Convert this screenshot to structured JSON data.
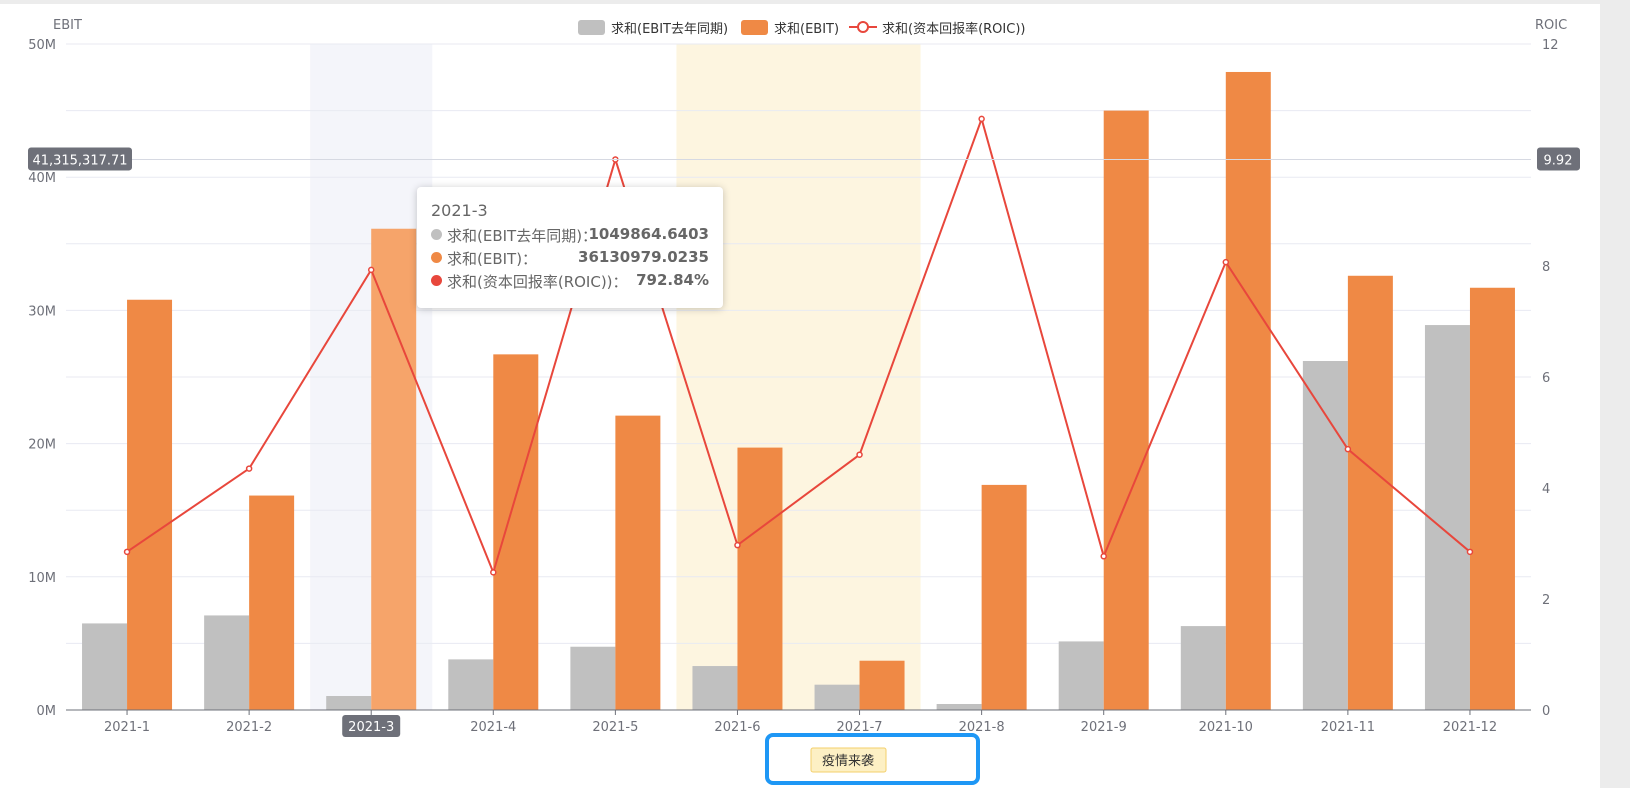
{
  "chart_data": {
    "type": "bar",
    "categories": [
      "2021-1",
      "2021-2",
      "2021-3",
      "2021-4",
      "2021-5",
      "2021-6",
      "2021-7",
      "2021-8",
      "2021-9",
      "2021-10",
      "2021-11",
      "2021-12"
    ],
    "series": [
      {
        "name": "求和(EBIT去年同期)",
        "kind": "bar",
        "axis": "left",
        "values": [
          6500000,
          7100000,
          1049864.6403,
          3800000,
          4750000,
          3300000,
          1900000,
          450000,
          5150000,
          6300000,
          26200000,
          28900000
        ]
      },
      {
        "name": "求和(EBIT)",
        "kind": "bar",
        "axis": "left",
        "values": [
          30800000,
          16100000,
          36130979.0235,
          26700000,
          22100000,
          19700000,
          3700000,
          16900000,
          45000000,
          47900000,
          32600000,
          31700000
        ]
      },
      {
        "name": "求和(资本回报率(ROIC))",
        "kind": "line",
        "axis": "right",
        "values": [
          2.85,
          4.35,
          7.93,
          2.48,
          9.92,
          2.97,
          4.6,
          10.65,
          2.77,
          8.07,
          4.7,
          2.85
        ]
      }
    ],
    "ylabel_left": "EBIT",
    "ylabel_right": "ROIC",
    "ylim_left": [
      0,
      50000000
    ],
    "ylim_right": [
      0,
      12
    ],
    "yticks_left": [
      0,
      10000000,
      20000000,
      30000000,
      40000000,
      50000000
    ],
    "yticks_left_labels": [
      "0M",
      "10M",
      "20M",
      "30M",
      "40M",
      "50M"
    ],
    "yticks_right": [
      0,
      2,
      4,
      6,
      8,
      12
    ],
    "yticks_right_labels": [
      "0",
      "2",
      "4",
      "6",
      "8",
      "12"
    ],
    "grid": true,
    "legend_position": "top-center",
    "colors": {
      "bar_prev": "#c0c0c0",
      "bar_ebit": "#ef8945",
      "bar_ebit_hover": "#f6a46a",
      "line": "#e8473c",
      "axis_label_bg": "#6e7079",
      "hover_band": "#f4f5fa",
      "period_band": "#fdf5e0"
    },
    "hover_category": "2021-3",
    "crosshair_left_label": "41,315,317.71",
    "crosshair_right_label": "9.92",
    "annotation": {
      "label": "疫情来袭",
      "from_category": "2021-6",
      "to_category": "2021-7"
    },
    "tooltip": {
      "title": "2021-3",
      "rows": [
        {
          "label": "求和(EBIT去年同期)：",
          "value": "1049864.6403"
        },
        {
          "label": "求和(EBIT)：",
          "value": "36130979.0235"
        },
        {
          "label": "求和(资本回报率(ROIC))：",
          "value": "792.84%"
        }
      ]
    }
  }
}
